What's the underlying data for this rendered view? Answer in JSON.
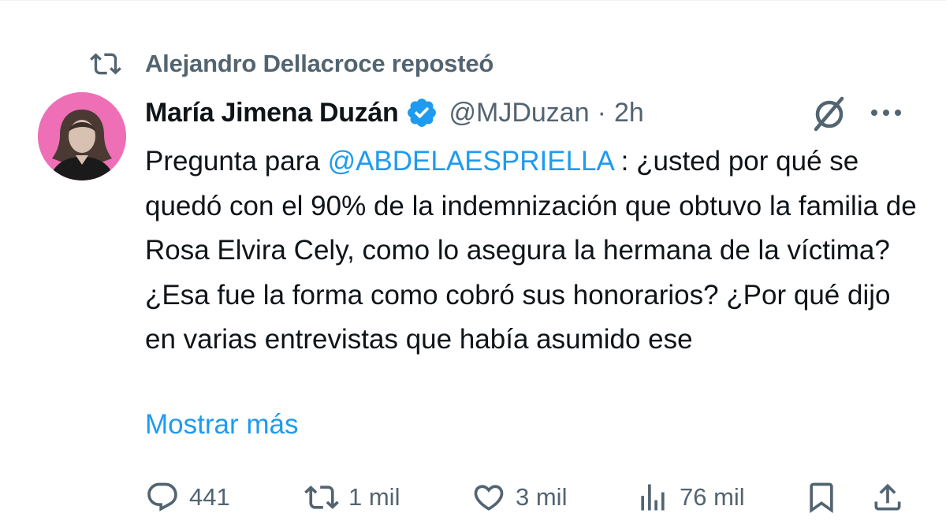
{
  "repost": {
    "text": "Alejandro Dellacroce reposteó",
    "icon": "repost-icon"
  },
  "author": {
    "display_name": "María Jimena Duzán",
    "verified_icon": "verified-badge-icon",
    "handle": "@MJDuzan",
    "separator": "·",
    "time": "2h"
  },
  "tweet": {
    "text_before_mention": "Pregunta para ",
    "mention": "@ABDELAESPRIELLA",
    "text_after_mention": " : ¿usted  por qué se quedó con el 90% de la indemnización que obtuvo la familia de Rosa Elvira Cely, como lo asegura la hermana de la víctima? ¿Esa fue la forma como cobró sus honorarios? ¿Por qué dijo en varias entrevistas que había asumido ese",
    "show_more": "Mostrar más"
  },
  "actions": {
    "replies": "441",
    "reposts": "1 mil",
    "likes": "3 mil",
    "views": "76 mil"
  },
  "colors": {
    "link": "#1d9bf0",
    "secondary_text": "#536471",
    "verified": "#1d9bf0",
    "avatar_bg": "#ef6fb6"
  }
}
